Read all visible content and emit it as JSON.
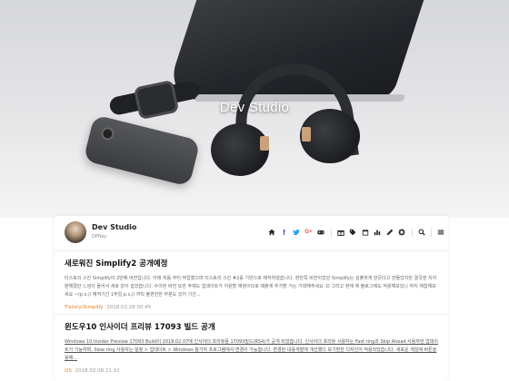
{
  "site": {
    "title": "Dev Studio"
  },
  "profile": {
    "name": "Dev Studio",
    "subtitle": "OPNsy"
  },
  "toolbar": {
    "icons": [
      "home-icon",
      "facebook-icon",
      "twitter-icon",
      "google-plus-icon",
      "gamepad-icon",
      "gift-icon",
      "tag-icon",
      "calendar-icon",
      "chart-icon",
      "pencil-icon",
      "gear-icon",
      "search-icon",
      "menu-icon"
    ],
    "facebook_glyph": "f",
    "google_glyph": "G+"
  },
  "posts": [
    {
      "title": "새로워진 Simplify2 공개예정",
      "body": "티스토리 스킨 Simplify의 2번째 버전입니다. 아래 처음 부터 작업했으며 티스토리 스킨 #2를 기반으로 제작하였습니다. 장반쪽 버전이었던 Simplify는 심플하게 만든다고 만들었지만 결국엔 지저분해졌던 느낌이 들어서 새로 같이 잡았습니다. 수이번 버전 또한 주제도 업데이트가 지원할 예정이므로 제플게 추가할 거는 기대해주세요 :D 그리고 현재 에 블로그에도 적용해보았니 하지 체험해보세요 ~(p.s.// 예적기간 1주일 p.s.// 까직 불편한한 부분도 있어 기간...",
      "category": "Tistory/Simplify",
      "date": "2018.02.28 00:45"
    },
    {
      "title": "윈도우10 인사이더 프리뷰 17093 빌드 공개",
      "body": "Windows 10 Insider Preview 17093 Build이 2018.02.07에 인사이더 프리뷰용 17093빌드(RS4)가 공개 되었습니다. 인사이더 프리뷰 사용자는 Fast ring과 Skip Ahead 사용자만 업데이트가 가능하며, Slow ring 사용자는 설정 > 업데이트 > Windows 참가자 프로그램에서 변경이 가능합니다. 변경된 내용개발에 개선했다 보기편한 디자인이 적용되었습니다. 새로운 게임에 버튼을 용해...",
      "category": "OS",
      "date": "2018.02.08 21:10"
    }
  ]
}
